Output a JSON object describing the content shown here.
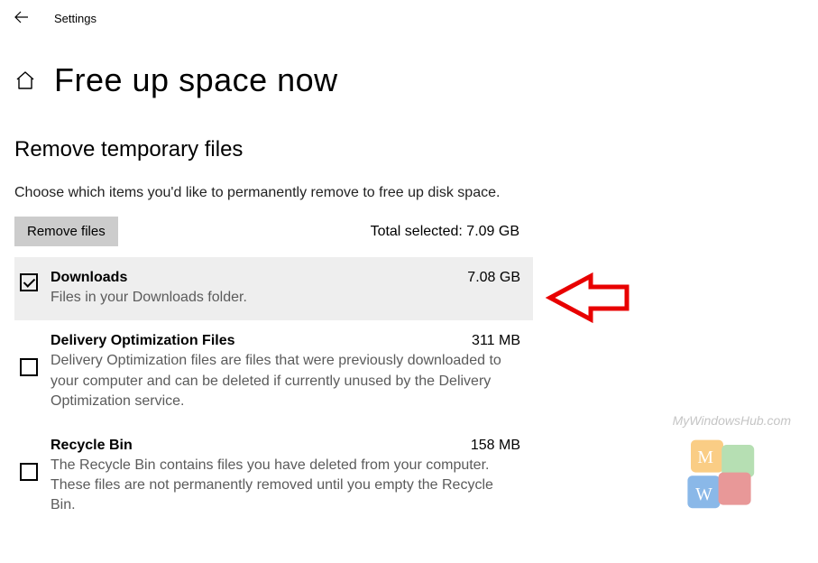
{
  "titlebar": {
    "label": "Settings"
  },
  "page": {
    "title": "Free up space now"
  },
  "section": {
    "title": "Remove temporary files",
    "instruction": "Choose which items you'd like to permanently remove to free up disk space.",
    "remove_button_label": "Remove files",
    "total_selected_label": "Total selected: 7.09 GB"
  },
  "items": [
    {
      "title": "Downloads",
      "size": "7.08 GB",
      "description": "Files in your Downloads folder.",
      "checked": true,
      "highlighted": true
    },
    {
      "title": "Delivery Optimization Files",
      "size": "311 MB",
      "description": "Delivery Optimization files are files that were previously downloaded to your computer and can be deleted if currently unused by the Delivery Optimization service.",
      "checked": false,
      "highlighted": false
    },
    {
      "title": "Recycle Bin",
      "size": "158 MB",
      "description": "The Recycle Bin contains files you have deleted from your computer. These files are not permanently removed until you empty the Recycle Bin.",
      "checked": false,
      "highlighted": false
    }
  ],
  "watermark": "MyWindowsHub.com"
}
